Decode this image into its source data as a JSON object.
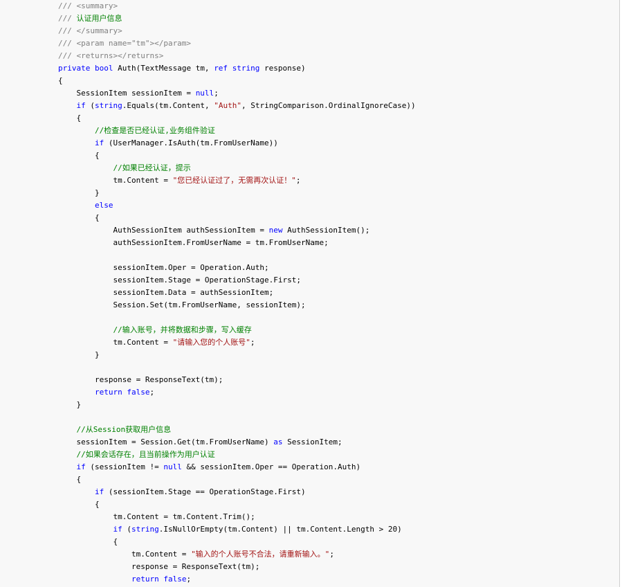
{
  "colors": {
    "background": "#f8f8f8",
    "keyword": "#0000ff",
    "comment": "#008000",
    "doc_comment": "#808080",
    "string": "#a31515",
    "text": "#000000"
  },
  "lines": [
    [
      {
        "t": "/// <summary>",
        "c": "doc"
      }
    ],
    [
      {
        "t": "/// ",
        "c": "doc"
      },
      {
        "t": "认证用户信息",
        "c": "cm"
      }
    ],
    [
      {
        "t": "/// </summary>",
        "c": "doc"
      }
    ],
    [
      {
        "t": "/// <param name=\"tm\"></param>",
        "c": "doc"
      }
    ],
    [
      {
        "t": "/// <returns></returns>",
        "c": "doc"
      }
    ],
    [
      {
        "t": "private",
        "c": "kw"
      },
      {
        "t": " "
      },
      {
        "t": "bool",
        "c": "kw"
      },
      {
        "t": " Auth(TextMessage tm, "
      },
      {
        "t": "ref",
        "c": "kw"
      },
      {
        "t": " "
      },
      {
        "t": "string",
        "c": "kw"
      },
      {
        "t": " response)"
      }
    ],
    [
      {
        "t": "{"
      }
    ],
    [
      {
        "t": "    SessionItem sessionItem = "
      },
      {
        "t": "null",
        "c": "kw"
      },
      {
        "t": ";"
      }
    ],
    [
      {
        "t": "    "
      },
      {
        "t": "if",
        "c": "kw"
      },
      {
        "t": " ("
      },
      {
        "t": "string",
        "c": "kw"
      },
      {
        "t": ".Equals(tm.Content, "
      },
      {
        "t": "\"Auth\"",
        "c": "str"
      },
      {
        "t": ", StringComparison.OrdinalIgnoreCase))"
      }
    ],
    [
      {
        "t": "    {"
      }
    ],
    [
      {
        "t": "        "
      },
      {
        "t": "//检查是否已经认证,业务组件验证",
        "c": "cm"
      }
    ],
    [
      {
        "t": "        "
      },
      {
        "t": "if",
        "c": "kw"
      },
      {
        "t": " (UserManager.IsAuth(tm.FromUserName))"
      }
    ],
    [
      {
        "t": "        {"
      }
    ],
    [
      {
        "t": "            "
      },
      {
        "t": "//如果已经认证，提示",
        "c": "cm"
      }
    ],
    [
      {
        "t": "            tm.Content = "
      },
      {
        "t": "\"您已经认证过了，无需再次认证！\"",
        "c": "str"
      },
      {
        "t": ";"
      }
    ],
    [
      {
        "t": "        }"
      }
    ],
    [
      {
        "t": "        "
      },
      {
        "t": "else",
        "c": "kw"
      }
    ],
    [
      {
        "t": "        {"
      }
    ],
    [
      {
        "t": "            AuthSessionItem authSessionItem = "
      },
      {
        "t": "new",
        "c": "kw"
      },
      {
        "t": " AuthSessionItem();"
      }
    ],
    [
      {
        "t": "            authSessionItem.FromUserName = tm.FromUserName;"
      }
    ],
    [
      {
        "t": ""
      }
    ],
    [
      {
        "t": "            sessionItem.Oper = Operation.Auth;"
      }
    ],
    [
      {
        "t": "            sessionItem.Stage = OperationStage.First;"
      }
    ],
    [
      {
        "t": "            sessionItem.Data = authSessionItem;"
      }
    ],
    [
      {
        "t": "            Session.Set(tm.FromUserName, sessionItem);"
      }
    ],
    [
      {
        "t": ""
      }
    ],
    [
      {
        "t": "            "
      },
      {
        "t": "//输入账号，并将数据和步骤，写入缓存",
        "c": "cm"
      }
    ],
    [
      {
        "t": "            tm.Content = "
      },
      {
        "t": "\"请输入您的个人账号\"",
        "c": "str"
      },
      {
        "t": ";"
      }
    ],
    [
      {
        "t": "        }"
      }
    ],
    [
      {
        "t": ""
      }
    ],
    [
      {
        "t": "        response = ResponseText(tm);"
      }
    ],
    [
      {
        "t": "        "
      },
      {
        "t": "return",
        "c": "kw"
      },
      {
        "t": " "
      },
      {
        "t": "false",
        "c": "kw"
      },
      {
        "t": ";"
      }
    ],
    [
      {
        "t": "    }"
      }
    ],
    [
      {
        "t": ""
      }
    ],
    [
      {
        "t": "    "
      },
      {
        "t": "//从Session获取用户信息",
        "c": "cm"
      }
    ],
    [
      {
        "t": "    sessionItem = Session.Get(tm.FromUserName) "
      },
      {
        "t": "as",
        "c": "kw"
      },
      {
        "t": " SessionItem;"
      }
    ],
    [
      {
        "t": "    "
      },
      {
        "t": "//如果会话存在，且当前操作为用户认证",
        "c": "cm"
      }
    ],
    [
      {
        "t": "    "
      },
      {
        "t": "if",
        "c": "kw"
      },
      {
        "t": " (sessionItem != "
      },
      {
        "t": "null",
        "c": "kw"
      },
      {
        "t": " && sessionItem.Oper == Operation.Auth)"
      }
    ],
    [
      {
        "t": "    {"
      }
    ],
    [
      {
        "t": "        "
      },
      {
        "t": "if",
        "c": "kw"
      },
      {
        "t": " (sessionItem.Stage == OperationStage.First)"
      }
    ],
    [
      {
        "t": "        {"
      }
    ],
    [
      {
        "t": "            tm.Content = tm.Content.Trim();"
      }
    ],
    [
      {
        "t": "            "
      },
      {
        "t": "if",
        "c": "kw"
      },
      {
        "t": " ("
      },
      {
        "t": "string",
        "c": "kw"
      },
      {
        "t": ".IsNullOrEmpty(tm.Content) || tm.Content.Length > 20)"
      }
    ],
    [
      {
        "t": "            {"
      }
    ],
    [
      {
        "t": "                tm.Content = "
      },
      {
        "t": "\"输入的个人账号不合法，请重新输入。\"",
        "c": "str"
      },
      {
        "t": ";"
      }
    ],
    [
      {
        "t": "                response = ResponseText(tm);"
      }
    ],
    [
      {
        "t": "                "
      },
      {
        "t": "return",
        "c": "kw"
      },
      {
        "t": " "
      },
      {
        "t": "false",
        "c": "kw"
      },
      {
        "t": ";"
      }
    ]
  ]
}
